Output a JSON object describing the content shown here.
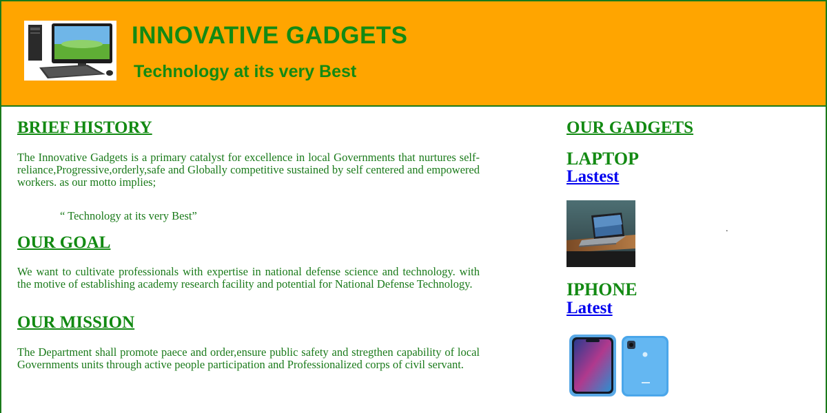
{
  "header": {
    "title": "INNOVATIVE GADGETS",
    "tagline": "Technology at its very Best",
    "logo_icon": "desktop-computer-icon"
  },
  "main": {
    "history": {
      "heading": "BRIEF HISTORY",
      "text": "The Innovative Gadgets is a primary catalyst for excellence in local Governments that nurtures self-reliance,Progressive,orderly,safe and Globally competitive sustained by self centered and empowered workers. as our motto implies;",
      "quote": "“ Technology at its very Best”"
    },
    "goal": {
      "heading": "OUR GOAL",
      "text": "We want to cultivate professionals with expertise in national defense science and technology. with the motive of establishing academy research facility and potential for National Defense Technology."
    },
    "mission": {
      "heading": "OUR MISSION",
      "text": "The Department shall promote paece and order,ensure public safety and stregthen capability of local Governments units through active people participation and Professionalized corps of civil servant."
    }
  },
  "sidebar": {
    "heading": "OUR GADGETS",
    "laptop": {
      "title": "LAPTOP",
      "link": "Lastest"
    },
    "iphone": {
      "title": "IPHONE",
      "link": "Latest"
    }
  },
  "colors": {
    "header_bg": "#ffa500",
    "heading_green": "#138a13",
    "text_green": "#1a7a1a",
    "link_blue": "#0000ee"
  }
}
